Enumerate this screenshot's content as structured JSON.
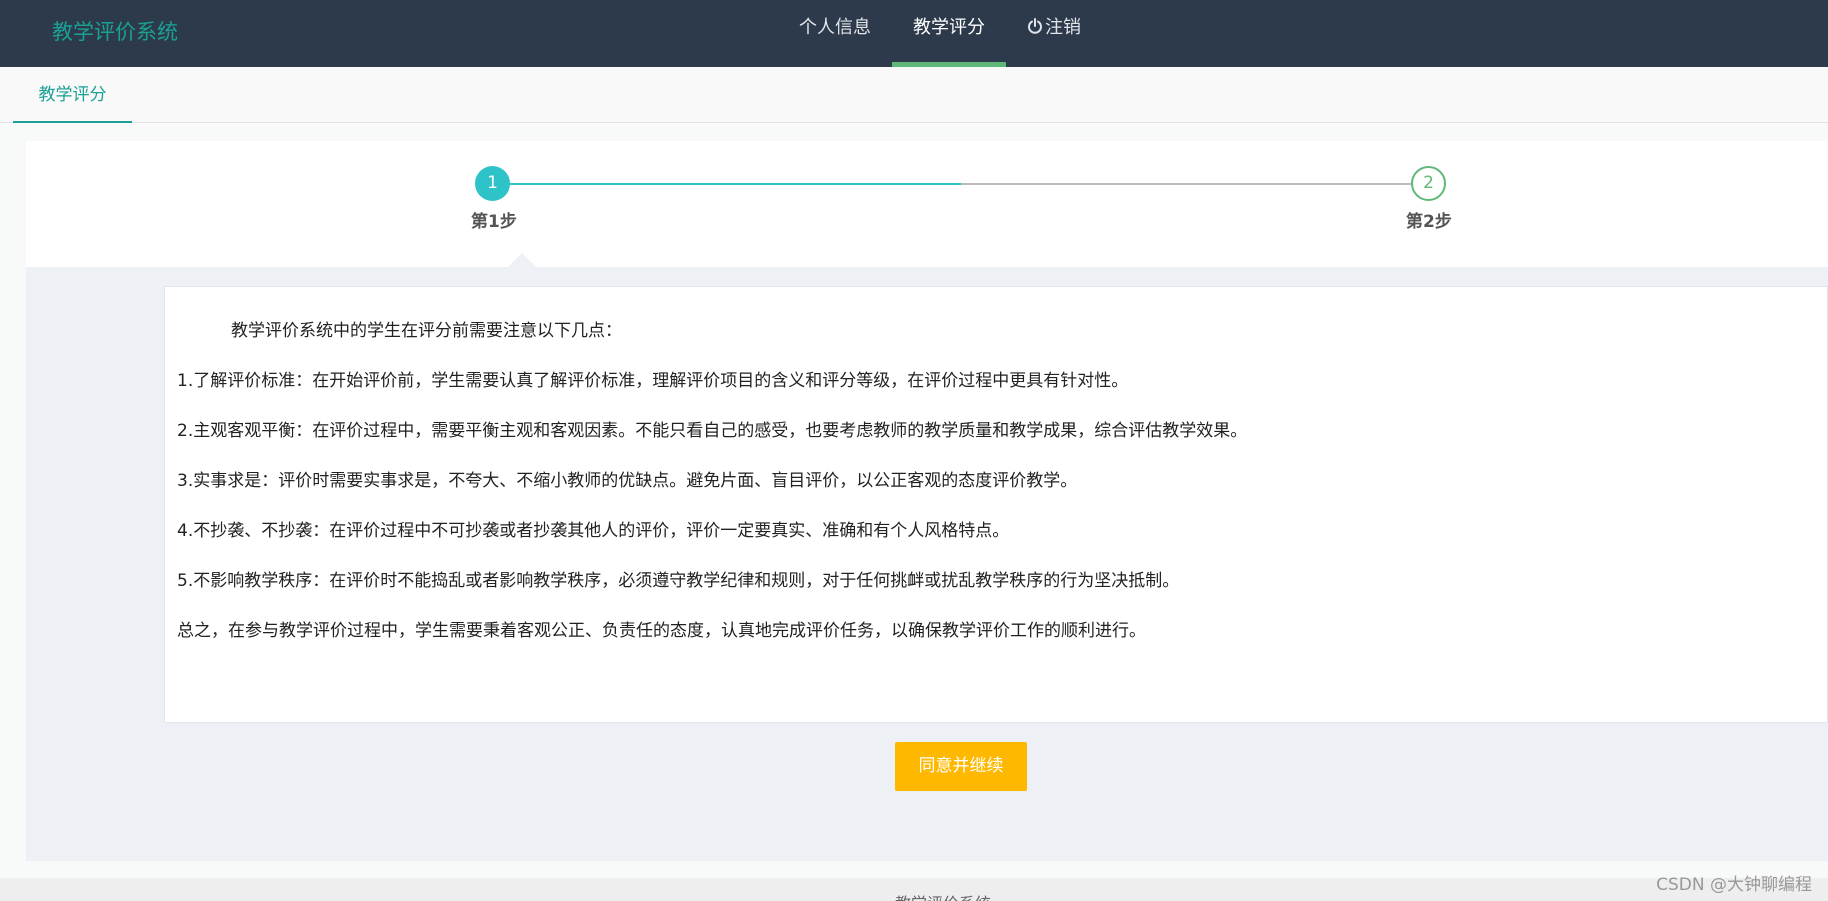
{
  "header": {
    "brand": "教学评价系统",
    "nav": [
      {
        "label": "个人信息"
      },
      {
        "label": "教学评分"
      },
      {
        "label": "注销"
      }
    ]
  },
  "tabs": [
    {
      "label": "教学评分"
    }
  ],
  "steps": [
    {
      "number": "1",
      "label": "第1步"
    },
    {
      "number": "2",
      "label": "第2步"
    }
  ],
  "notice": {
    "intro": "教学评价系统中的学生在评分前需要注意以下几点：",
    "points": [
      "1.了解评价标准：在开始评价前，学生需要认真了解评价标准，理解评价项目的含义和评分等级，在评价过程中更具有针对性。",
      "2.主观客观平衡：在评价过程中，需要平衡主观和客观因素。不能只看自己的感受，也要考虑教师的教学质量和教学成果，综合评估教学效果。",
      "3.实事求是：评价时需要实事求是，不夸大、不缩小教师的优缺点。避免片面、盲目评价，以公正客观的态度评价教学。",
      "4.不抄袭、不抄袭：在评价过程中不可抄袭或者抄袭其他人的评价，评价一定要真实、准确和有个人风格特点。",
      "5.不影响教学秩序：在评价时不能捣乱或者影响教学秩序，必须遵守教学纪律和规则，对于任何挑衅或扰乱教学秩序的行为坚决抵制。",
      "总之，在参与教学评价过程中，学生需要秉着客观公正、负责任的态度，认真地完成评价任务，以确保教学评价工作的顺利进行。"
    ]
  },
  "continue_button": "同意并继续",
  "footer": "教学评价系统",
  "watermark": "CSDN @大钟聊编程",
  "colors": {
    "topbar": "#2d3a4b",
    "brand": "#1aa094",
    "nav_active_underline": "#5fb878",
    "step_active": "#2ec3c8",
    "button": "#ffb800"
  }
}
